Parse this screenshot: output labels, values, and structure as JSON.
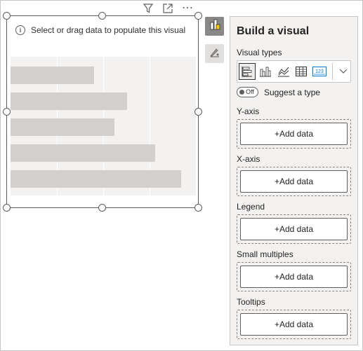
{
  "visual": {
    "placeholder_text": "Select or drag data to populate this visual",
    "placeholder_bar_lengths": [
      0.45,
      0.63,
      0.56,
      0.78,
      0.92
    ],
    "header_icons": [
      "filter-icon",
      "focus-mode-icon",
      "more-options-icon"
    ],
    "more_label": "⋯"
  },
  "pane": {
    "title": "Build a visual",
    "visual_types_label": "Visual types",
    "visual_types": [
      "stacked-bar-chart-icon",
      "clustered-column-chart-icon",
      "line-chart-icon",
      "table-icon",
      "card-icon"
    ],
    "selected_visual_type": "stacked-bar-chart-icon",
    "card_icon_text": "123",
    "suggest_toggle_state": "Off",
    "suggest_label": "Suggest a type",
    "wells": [
      {
        "label": "Y-axis",
        "button": "+Add data"
      },
      {
        "label": "X-axis",
        "button": "+Add data"
      },
      {
        "label": "Legend",
        "button": "+Add data"
      },
      {
        "label": "Small multiples",
        "button": "+Add data"
      },
      {
        "label": "Tooltips",
        "button": "+Add data"
      }
    ]
  },
  "colors": {
    "accent": "#0078d4",
    "placeholder_bar": "#d2d0ce",
    "pane_background": "#f3f2f1"
  }
}
